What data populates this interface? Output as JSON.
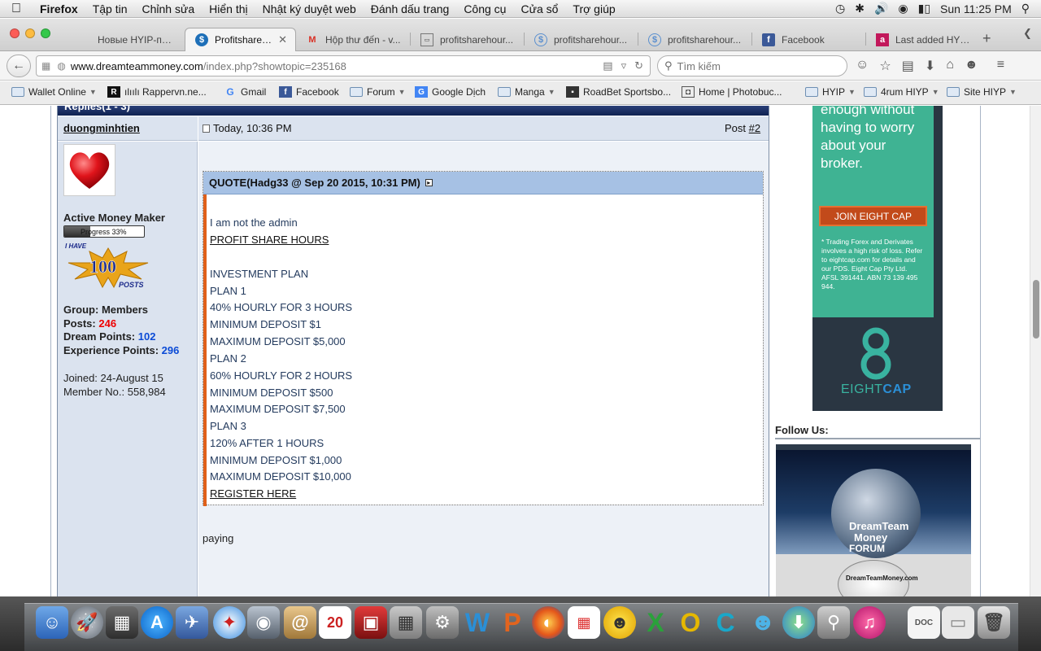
{
  "menubar": {
    "app": "Firefox",
    "items": [
      "Tập tin",
      "Chỉnh sửa",
      "Hiển thị",
      "Nhật ký duyệt web",
      "Đánh dấu trang",
      "Công cụ",
      "Cửa sổ",
      "Trợ giúp"
    ],
    "clock": "Sun 11:25 PM"
  },
  "tabs": [
    {
      "label": "Новые HYIP-проект...",
      "icon": "page-icon"
    },
    {
      "label": "Profitshareh...",
      "icon": "dollar-icon"
    },
    {
      "label": "Hộp thư đến - v...",
      "icon": "gmail-icon"
    },
    {
      "label": "profitsharehour...",
      "icon": "page-icon"
    },
    {
      "label": "profitsharehour...",
      "icon": "dollar-icon"
    },
    {
      "label": "profitsharehour...",
      "icon": "dollar-icon"
    },
    {
      "label": "Facebook",
      "icon": "facebook-icon"
    },
    {
      "label": "Last added HYIP...",
      "icon": "page-icon"
    }
  ],
  "urlbar": {
    "domain": "www.dreamteammoney.com",
    "path": "/index.php?showtopic=235168"
  },
  "search": {
    "placeholder": "Tìm kiếm"
  },
  "bookmarks": [
    {
      "label": "Wallet Online",
      "type": "folder",
      "dropdown": true
    },
    {
      "label": "ılıılı Rappervn.ne...",
      "type": "site"
    },
    {
      "label": "Gmail",
      "type": "google"
    },
    {
      "label": "Facebook",
      "type": "facebook"
    },
    {
      "label": "Forum",
      "type": "folder",
      "dropdown": true
    },
    {
      "label": "Google Dịch",
      "type": "translate"
    },
    {
      "label": "Manga",
      "type": "folder",
      "dropdown": true
    },
    {
      "label": "RoadBet Sportsbo...",
      "type": "site"
    },
    {
      "label": "Home | Photobuc...",
      "type": "site"
    },
    {
      "label": "HYIP",
      "type": "folder",
      "dropdown": true
    },
    {
      "label": "4rum HIYP",
      "type": "folder",
      "dropdown": true
    },
    {
      "label": "Site HIYP",
      "type": "folder",
      "dropdown": true
    }
  ],
  "post": {
    "topbar_title": "Replies(1 - 3)",
    "author": "duongminhtien",
    "time": "Today, 10:36 PM",
    "post_label": "Post",
    "post_number": "#2",
    "rank": "Active Money Maker",
    "progress_label": "Progress 33%",
    "progress_value": 0.33,
    "badge_top": "I HAVE",
    "badge_num": "100",
    "badge_bottom": "POSTS",
    "group_label": "Group:",
    "group_value": "Members",
    "posts_label": "Posts:",
    "posts_value": "246",
    "dream_label": "Dream Points:",
    "dream_value": "102",
    "exp_label": "Experience Points:",
    "exp_value": "296",
    "joined": "Joined: 24-August 15",
    "member_no": "Member No.: 558,984",
    "quote_header": "QUOTE(Hadg33 @ Sep 20 2015, 10:31 PM)",
    "quote_lines": [
      {
        "text": "I am not the admin",
        "link": false
      },
      {
        "text": "PROFIT SHARE HOURS",
        "link": true
      },
      {
        "text": "INVESTMENT PLAN",
        "link": false
      },
      {
        "text": "PLAN 1",
        "link": false
      },
      {
        "text": "40% HOURLY FOR 3 HOURS",
        "link": false
      },
      {
        "text": "MINIMUM DEPOSIT $1",
        "link": false
      },
      {
        "text": "MAXIMUM DEPOSIT $5,000",
        "link": false
      },
      {
        "text": "PLAN 2",
        "link": false
      },
      {
        "text": "60% HOURLY FOR 2 HOURS",
        "link": false
      },
      {
        "text": "MINIMUM DEPOSIT $500",
        "link": false
      },
      {
        "text": "MAXIMUM DEPOSIT $7,500",
        "link": false
      },
      {
        "text": "PLAN 3",
        "link": false
      },
      {
        "text": "120% AFTER 1 HOURS",
        "link": false
      },
      {
        "text": "MINIMUM DEPOSIT $1,000",
        "link": false
      },
      {
        "text": "MAXIMUM DEPOSIT $10,000",
        "link": false
      },
      {
        "text": "REGISTER HERE",
        "link": true
      }
    ],
    "reply_text": "paying"
  },
  "sidebar": {
    "ad_lines": [
      "enough without",
      "having to worry",
      "about your",
      "broker."
    ],
    "ad_button": "JOIN EIGHT CAP",
    "ad_disclaimer": [
      "* Trading Forex and Derivates",
      "involves a high risk of loss. Refer",
      "to eightcap.com for details and",
      "our PDS. Eight Cap Pty Ltd.",
      "AFSL 391441. ABN 73 139 495",
      "944."
    ],
    "ad_logo_word1": "EIGHT",
    "ad_logo_word2": "CAP",
    "follow_us": "Follow Us:",
    "dtm_title1": "DreamTeam",
    "dtm_title2": "Money",
    "dtm_title3": "FORUM",
    "dtm_coin": "DreamTeamMoney.com"
  },
  "colors": {
    "quote_bar": "#e0601a",
    "quote_header_bg": "#a6c1e4",
    "posts_value": "#e00000",
    "points_value": "#0b4bd6",
    "ad_teal": "#3fb393",
    "ad_button": "#c24a1a"
  }
}
